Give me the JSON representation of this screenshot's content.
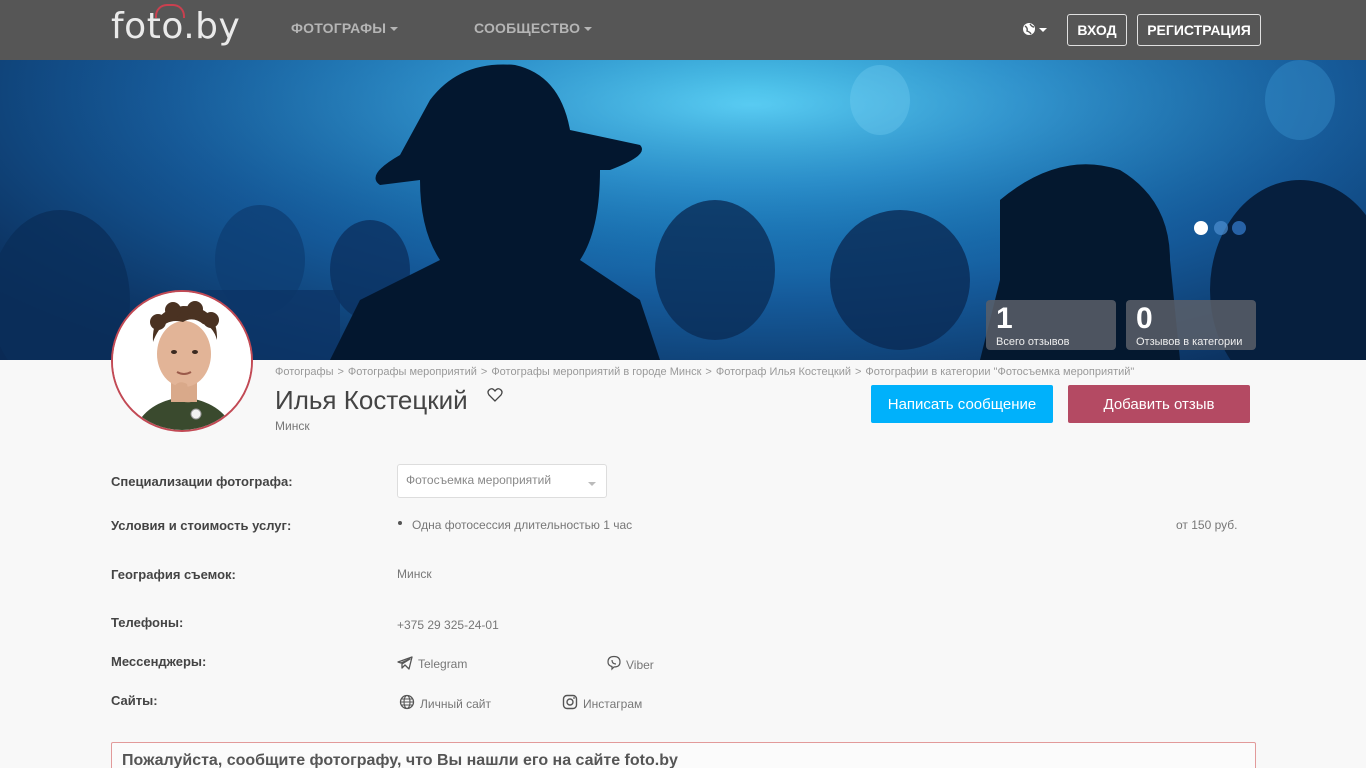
{
  "header": {
    "logo_text": "foto.by",
    "nav": [
      {
        "label": "ФОТОГРАФЫ"
      },
      {
        "label": "СООБЩЕСТВО"
      }
    ],
    "login_label": "ВХОД",
    "register_label": "РЕГИСТРАЦИЯ"
  },
  "hero": {
    "stats": [
      {
        "value": "1",
        "label": "Всего отзывов"
      },
      {
        "value": "0",
        "label": "Отзывов в категории"
      }
    ]
  },
  "breadcrumb": [
    "Фотографы",
    "Фотографы мероприятий",
    "Фотографы мероприятий в городе Минск",
    "Фотограф Илья Костецкий",
    "Фотографии в категории \"Фотосъемка мероприятий\""
  ],
  "breadcrumb_separator": ">",
  "profile": {
    "name": "Илья Костецкий",
    "city": "Минск"
  },
  "actions": {
    "write_message": "Написать сообщение",
    "add_review": "Добавить отзыв"
  },
  "details": {
    "specializations_label": "Специализации фотографа:",
    "specialization_value": "Фотосъемка мероприятий",
    "services_label": "Условия и стоимость услуг:",
    "service_name": "Одна фотосессия длительностью 1 час",
    "service_price": "от 150 руб.",
    "geo_label": "География съемок:",
    "geo_value": "Минск",
    "phones_label": "Телефоны:",
    "phone_value": "+375 29 325-24-01",
    "messengers_label": "Мессенджеры:",
    "telegram": "Telegram",
    "viber": "Viber",
    "sites_label": "Сайты:",
    "personal_site": "Личный сайт",
    "instagram": "Инстаграм"
  },
  "notice": {
    "text": "Пожалуйста, сообщите фотографу, что Вы нашли его на сайте foto.by"
  },
  "colors": {
    "topbar": "#565656",
    "accent_blue": "#00b1fb",
    "accent_red": "#b44a63"
  }
}
